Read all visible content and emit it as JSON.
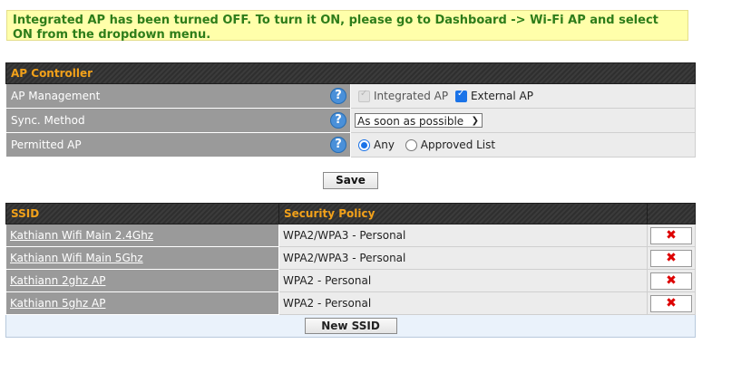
{
  "notice": {
    "text": "Integrated AP has been turned OFF. To turn it ON, please go to Dashboard -> Wi-Fi AP and select ON from the dropdown menu."
  },
  "ap_controller": {
    "title": "AP Controller",
    "rows": {
      "management": {
        "label": "AP Management",
        "integrated_label": "Integrated AP",
        "integrated_checked": true,
        "integrated_disabled": true,
        "external_label": "External AP",
        "external_checked": true
      },
      "sync": {
        "label": "Sync. Method",
        "selected": "As soon as possible"
      },
      "permitted": {
        "label": "Permitted AP",
        "any_label": "Any",
        "approved_label": "Approved List",
        "selected": "Any"
      }
    },
    "help_glyph": "?"
  },
  "save_label": "Save",
  "ssid_table": {
    "headers": {
      "ssid": "SSID",
      "policy": "Security Policy"
    },
    "rows": [
      {
        "ssid": "Kathiann Wifi Main 2.4Ghz",
        "policy": "WPA2/WPA3 - Personal"
      },
      {
        "ssid": "Kathiann Wifi Main 5Ghz",
        "policy": "WPA2/WPA3 - Personal"
      },
      {
        "ssid": "Kathiann 2ghz AP",
        "policy": "WPA2 - Personal"
      },
      {
        "ssid": "Kathiann 5ghz AP",
        "policy": "WPA2 - Personal"
      }
    ],
    "delete_glyph": "✖",
    "new_ssid_label": "New SSID"
  },
  "colors": {
    "header_text": "#f2a11a",
    "notice_text": "#2e7d1a",
    "notice_bg": "#ffffaa",
    "delete": "#dd0000"
  }
}
